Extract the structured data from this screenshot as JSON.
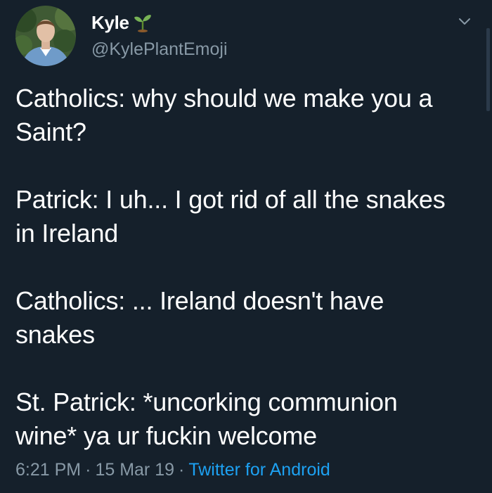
{
  "user": {
    "display_name": "Kyle",
    "handle": "@KylePlantEmoji",
    "name_emoji": "seedling-icon"
  },
  "tweet": {
    "paragraphs": [
      "Catholics: why should we make you a\nSaint?",
      "Patrick: I uh... I got rid of all the snakes\nin Ireland",
      "Catholics: ... Ireland doesn't have\nsnakes",
      "St. Patrick: *uncorking communion\nwine* ya ur fuckin welcome"
    ]
  },
  "meta": {
    "time": "6:21 PM",
    "date": "15 Mar 19",
    "separator": "·",
    "source": "Twitter for Android"
  },
  "colors": {
    "background": "#15202b",
    "text": "#ffffff",
    "muted": "#8899a6",
    "link": "#1da1f2"
  }
}
